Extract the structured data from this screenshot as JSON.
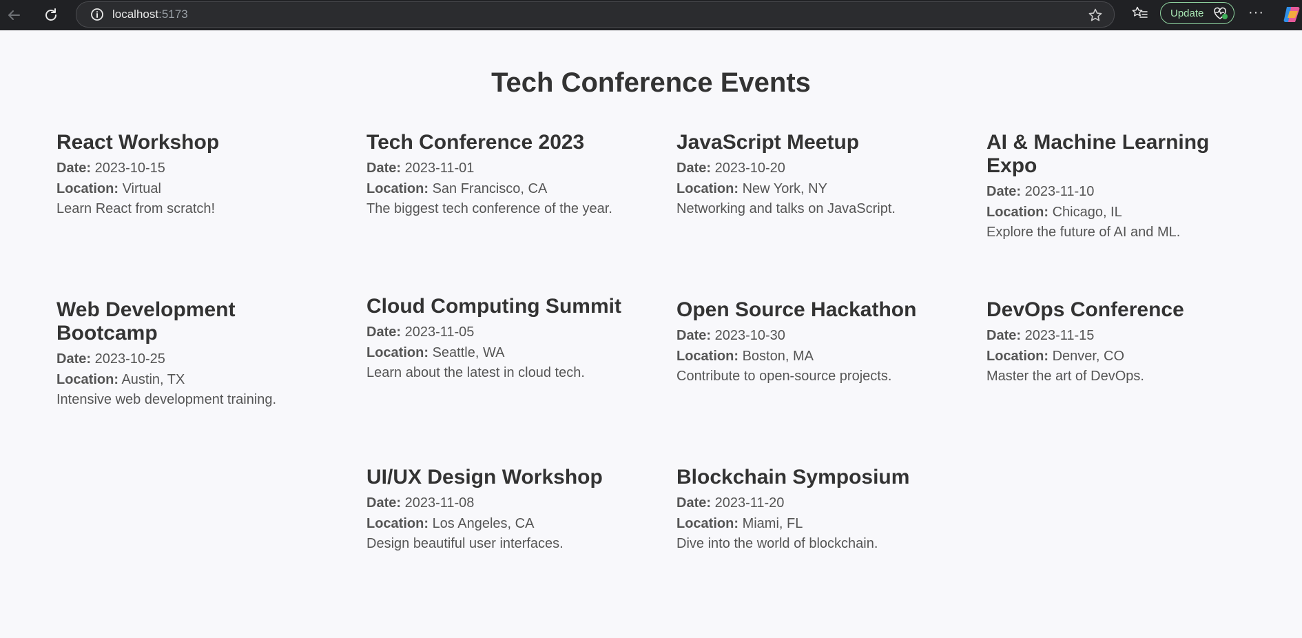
{
  "browser": {
    "url_host": "localhost",
    "url_port": ":5173",
    "update_label": "Update",
    "more_label": "···"
  },
  "page": {
    "title": "Tech Conference Events",
    "date_label": "Date:",
    "location_label": "Location:"
  },
  "events": [
    {
      "name": "React Workshop",
      "date": "2023-10-15",
      "location": "Virtual",
      "description": "Learn React from scratch!"
    },
    {
      "name": "Tech Conference 2023",
      "date": "2023-11-01",
      "location": "San Francisco, CA",
      "description": "The biggest tech conference of the year."
    },
    {
      "name": "JavaScript Meetup",
      "date": "2023-10-20",
      "location": "New York, NY",
      "description": "Networking and talks on JavaScript."
    },
    {
      "name": "AI & Machine Learning Expo",
      "date": "2023-11-10",
      "location": "Chicago, IL",
      "description": "Explore the future of AI and ML."
    },
    {
      "name": "Web Development Bootcamp",
      "date": "2023-10-25",
      "location": "Austin, TX",
      "description": "Intensive web development training."
    },
    {
      "name": "Cloud Computing Summit",
      "date": "2023-11-05",
      "location": "Seattle, WA",
      "description": "Learn about the latest in cloud tech."
    },
    {
      "name": "Open Source Hackathon",
      "date": "2023-10-30",
      "location": "Boston, MA",
      "description": "Contribute to open-source projects."
    },
    {
      "name": "DevOps Conference",
      "date": "2023-11-15",
      "location": "Denver, CO",
      "description": "Master the art of DevOps."
    },
    {
      "name": "UI/UX Design Workshop",
      "date": "2023-11-08",
      "location": "Los Angeles, CA",
      "description": "Design beautiful user interfaces."
    },
    {
      "name": "Blockchain Symposium",
      "date": "2023-11-20",
      "location": "Miami, FL",
      "description": "Dive into the world of blockchain."
    }
  ]
}
